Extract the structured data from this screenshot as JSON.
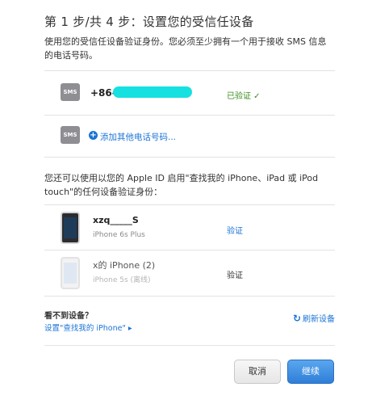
{
  "header": {
    "title": "第 1 步/共 4 步：设置您的受信任设备",
    "intro": "使用您的受信任设备验证身份。您必须至少拥有一个用于接收 SMS 信息的电话号码。"
  },
  "phones": {
    "sms_badge": "SMS",
    "primary_number": "+86-",
    "primary_status": "已验证 ✓",
    "add_label": "添加其他电话号码..."
  },
  "devices_section": {
    "description": "您还可以使用以您的 Apple ID 启用\"查找我的 iPhone、iPad 或 iPod touch\"的任何设备验证身份：",
    "devices": [
      {
        "name": "xzq_____S",
        "model": "iPhone 6s Plus",
        "action": "验证"
      },
      {
        "name": "x的 iPhone (2)",
        "model": "iPhone 5s (离线)",
        "action": "验证"
      }
    ]
  },
  "footer": {
    "no_device": "看不到设备？",
    "setup_link": "设置\"查找我的 iPhone\" ▸",
    "refresh": "刷新设备",
    "cancel": "取消",
    "continue": "继续"
  },
  "colors": {
    "link": "#1b74d6",
    "verified": "#3b8d1e",
    "primary_button": "#2f7fd8"
  }
}
